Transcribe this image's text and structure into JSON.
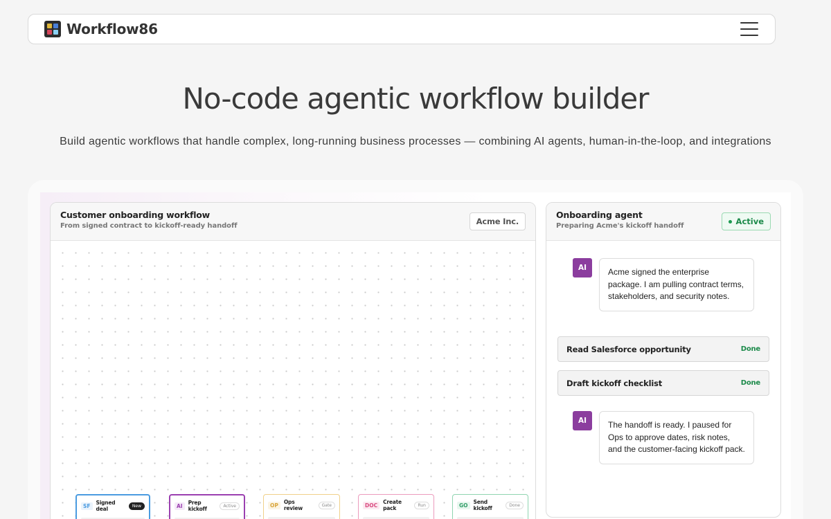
{
  "nav": {
    "brand": "Workflow86",
    "logo_colors": [
      "#e0b73a",
      "#4a7fd6",
      "#d6455a",
      "#8ad0f2"
    ],
    "menu_icon": "hamburger-menu-icon"
  },
  "hero": {
    "title": "No-code agentic workflow builder",
    "subtitle": "Build agentic workflows that handle complex, long-running business processes — combining AI agents, human-in-the-loop, and integrations"
  },
  "workflow": {
    "title": "Customer onboarding workflow",
    "subtitle": "From signed contract to kickoff-ready handoff",
    "org_tag": "Acme Inc.",
    "nodes": [
      {
        "code": "SF",
        "title": "Signed deal",
        "badge": "New",
        "color": "#4a9be0"
      },
      {
        "code": "AI",
        "title": "Prep kickoff",
        "badge": "Active",
        "color": "#9b3fb0"
      },
      {
        "code": "OP",
        "title": "Ops review",
        "badge": "Gate",
        "color": "#e5b85a"
      },
      {
        "code": "DOC",
        "title": "Create pack",
        "badge": "Run",
        "color": "#e06a9a"
      },
      {
        "code": "GO",
        "title": "Send kickoff",
        "badge": "Done",
        "color": "#3cb37a"
      }
    ]
  },
  "agent": {
    "title": "Onboarding agent",
    "subtitle": "Preparing Acme's kickoff handoff",
    "status": "Active",
    "status_color": "#1c8a4a",
    "avatar_label": "AI",
    "messages": [
      "Acme signed the enterprise package. I am pulling contract terms, stakeholders, and security notes.",
      "The handoff is ready. I paused for Ops to approve dates, risk notes, and the customer-facing kickoff pack."
    ],
    "tasks": [
      {
        "label": "Read Salesforce opportunity",
        "status": "Done"
      },
      {
        "label": "Draft kickoff checklist",
        "status": "Done"
      }
    ]
  }
}
